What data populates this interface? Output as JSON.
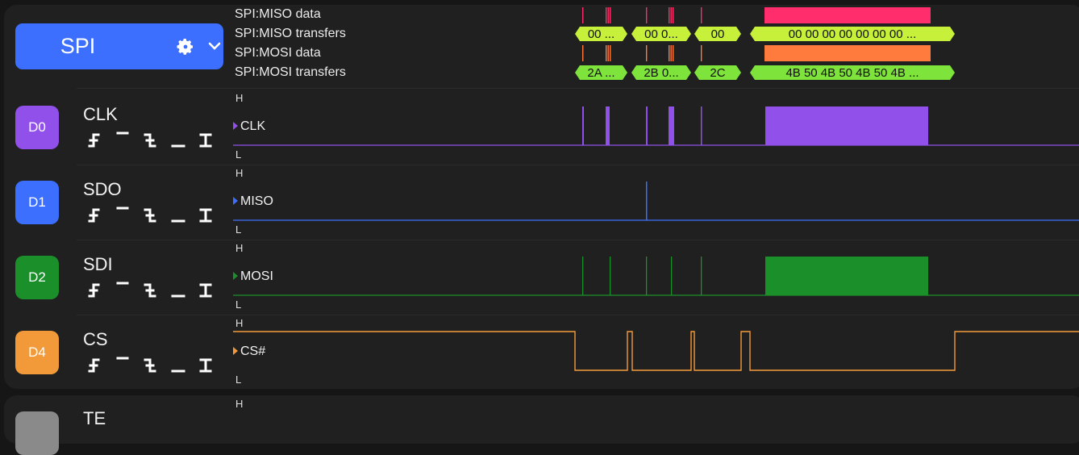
{
  "analyzer": {
    "label": "SPI",
    "settings_icon": "gear-icon",
    "expand_icon": "chevron-down-icon",
    "color": "#3d6fff"
  },
  "annotations": {
    "rows": [
      {
        "label": "SPI:MISO data"
      },
      {
        "label": "SPI:MISO transfers"
      },
      {
        "label": "SPI:MOSI data"
      },
      {
        "label": "SPI:MOSI transfers"
      }
    ],
    "miso_transfers": [
      "00 ...",
      "00 0...",
      "00",
      "00 00 00 00 00 00 00 ..."
    ],
    "mosi_transfers": [
      "2A ...",
      "2B 0...",
      "2C",
      "4B 50 4B 50 4B 50 4B ..."
    ],
    "colors": {
      "miso_data": "#ff2d6b",
      "miso_transfer": "#c6f03a",
      "mosi_data": "#ff7a3d",
      "mosi_transfer": "#7ee33a"
    }
  },
  "level_labels": {
    "high": "H",
    "low": "L"
  },
  "channels": [
    {
      "badge": "D0",
      "name": "CLK",
      "signal": "CLK",
      "color": "#9150ea"
    },
    {
      "badge": "D1",
      "name": "SDO",
      "signal": "MISO",
      "color": "#3d6fff"
    },
    {
      "badge": "D2",
      "name": "SDI",
      "signal": "MOSI",
      "color": "#1b8f2a"
    },
    {
      "badge": "D4",
      "name": "CS",
      "signal": "CS#",
      "color": "#f29a3a"
    },
    {
      "badge": "",
      "name": "TE",
      "signal": "",
      "color": "#8a8a8a"
    }
  ],
  "trigger_icons": [
    "rising-edge-icon",
    "high-level-icon",
    "falling-edge-icon",
    "low-level-icon",
    "any-edge-icon"
  ]
}
